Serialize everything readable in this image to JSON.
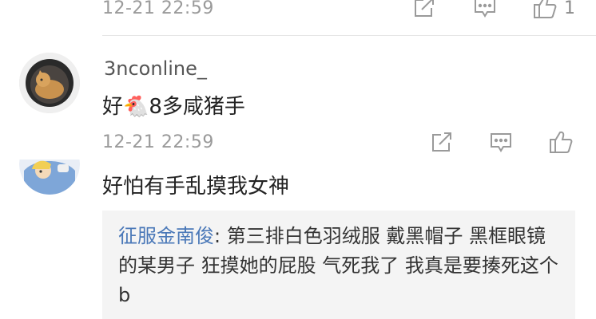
{
  "comments": [
    {
      "time": "12-21 22:59",
      "like_count": "1"
    },
    {
      "username": "3nconline_",
      "text_before_emoji": "好",
      "emoji": "🐔",
      "text_after_emoji": "8多咸猪手",
      "time": "12-21 22:59"
    },
    {
      "text": "好怕有手乱摸我女神",
      "quote": {
        "user": "征服金南俊",
        "separator": ": ",
        "text": "第三排白色羽绒服 戴黑帽子 黑框眼镜的某男子 狂摸她的屁股 气死我了 我真是要揍死这个b"
      }
    }
  ],
  "icons": {
    "share": "share-icon",
    "comment": "comment-icon",
    "like": "thumbs-up-icon"
  }
}
